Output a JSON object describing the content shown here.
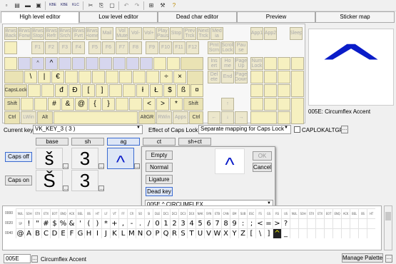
{
  "toolbar": {
    "icons": [
      "new-icon",
      "open-icon",
      "save-icon",
      "copy-icon",
      "keyboard-kbe-icon",
      "keyboard-kbe2-icon",
      "keyboard-klc-icon",
      "cut-icon",
      "copy2-icon",
      "paste-icon",
      "undo-icon",
      "redo-icon",
      "grid-icon",
      "tools-icon",
      "help-icon"
    ],
    "labels": [
      "▫",
      "▤",
      "▬",
      "▣",
      "KBE",
      "KBE",
      "KLC",
      "✂",
      "⎘",
      "▢",
      "↶",
      "↷",
      "⊞",
      "⚒",
      "?"
    ]
  },
  "tabs": [
    {
      "label": "High level editor"
    },
    {
      "label": "Low level editor"
    },
    {
      "label": "Dead char editor"
    },
    {
      "label": "Preview"
    },
    {
      "label": "Sticker map"
    }
  ],
  "keyboard": {
    "row_media": [
      "Brws Back",
      "Brws Forw",
      "Brws Stop",
      "Brws Refr",
      "Brws Srch",
      "Brws Fvrt",
      "Brws Home",
      "Mail",
      "Vol Mute",
      "Vol-",
      "Vol+",
      "Play Paus",
      "Stop",
      "Prev Trck",
      "Next Trck",
      "Med ia",
      "App1",
      "App2",
      "Sleep"
    ],
    "row_fn": [
      "F1",
      "F2",
      "F3",
      "F4",
      "F5",
      "F6",
      "F7",
      "F8",
      "F9",
      "F10",
      "F11",
      "F12",
      "Prnt Scrn",
      "Scroll Lock",
      "Pau se"
    ],
    "row_num": [
      "",
      "",
      "^",
      "",
      "",
      "",
      "",
      "",
      "",
      "",
      "",
      "",
      "",
      ""
    ],
    "nav1": [
      "Ins ert",
      "Ho me",
      "Page Up",
      "Num Lock"
    ],
    "row_q": [
      "",
      "\\",
      "|",
      "€",
      "",
      "",
      "",
      "",
      "",
      "",
      "",
      "÷",
      "×"
    ],
    "nav2": [
      "Del ete",
      "End",
      "Page Down"
    ],
    "caps": "CapsLock",
    "row_a": [
      "",
      "",
      "đ",
      "Đ",
      "[",
      "]",
      "",
      "",
      "ł",
      "Ł",
      "$",
      "ß",
      "¤"
    ],
    "shift_l": "Shift",
    "row_z": [
      "",
      "",
      "#",
      "&",
      "@",
      "{",
      "}",
      "",
      "",
      "<",
      ">",
      "*"
    ],
    "shift_r": "Shift",
    "ctrl_l": "Ctrl",
    "lwin": "LWin",
    "alt": "Alt",
    "altgr": "AltGR",
    "rwin": "RWin",
    "apps": "Apps",
    "ctrl_r": "Ctrl",
    "arrows": [
      "←",
      "↑",
      "↓",
      "→"
    ],
    "preview_glyph": "^",
    "preview_caption": "005E: Circumflex Accent"
  },
  "current_key": {
    "label": "Current key",
    "value": "VK_KEY_3 ( 3 )"
  },
  "caps_effect": {
    "label": "Effect of Caps Lock",
    "value": "Separate mapping for Caps Lock",
    "checkbox_label": "CAPLOKALTGR"
  },
  "columns": [
    "base",
    "sh",
    "ag",
    "ct",
    "sh+ct"
  ],
  "buttons": {
    "caps_off": "Caps off",
    "caps_on": "Caps on",
    "empty": "Empty",
    "normal": "Normal",
    "ligature": "Ligature",
    "dead_key": "Dead key",
    "ok": "OK",
    "cancel": "Cancel",
    "manage_palette": "Manage Palette"
  },
  "cells": {
    "off_base": "š",
    "off_sh": "3",
    "off_ag": "^",
    "on_base": "Š",
    "on_sh": "3"
  },
  "popup": {
    "glyph": "^",
    "dropdown": "005E ^ CIRCUMFLEX"
  },
  "charmap": {
    "rows": [
      {
        "hdr": "0000",
        "cells": [
          "NUL",
          "SOH",
          "STX",
          "ETX",
          "EOT",
          "ENQ",
          "ACK",
          "BEL",
          "BS",
          "HT",
          "LF",
          "VT",
          "FF",
          "CR",
          "SO",
          "SI",
          "DLE",
          "DC1",
          "DC2",
          "DC3",
          "DC4",
          "NAK",
          "SYN",
          "ETB",
          "CAN",
          "EM",
          "SUB",
          "ESC",
          "FS",
          "GS",
          "RS",
          "US",
          "NUL",
          "SOH",
          "STX",
          "ETX",
          "EOT",
          "ENQ",
          "ACK",
          "BEL",
          "BS",
          "HT"
        ]
      },
      {
        "hdr": "0020",
        "cells": [
          "SP",
          "!",
          "\"",
          "#",
          "$",
          "%",
          "&",
          "'",
          "(",
          ")",
          "*",
          "+",
          ",",
          "-",
          ".",
          "/",
          "0",
          "1",
          "2",
          "3",
          "4",
          "5",
          "6",
          "7",
          "8",
          "9",
          ":",
          ";",
          "<",
          "=",
          ">",
          "?",
          "",
          "",
          "",
          "",
          "",
          "",
          "",
          "",
          "",
          ""
        ]
      },
      {
        "hdr": "0040",
        "cells": [
          "@",
          "A",
          "B",
          "C",
          "D",
          "E",
          "F",
          "G",
          "H",
          "I",
          "J",
          "K",
          "L",
          "M",
          "N",
          "O",
          "P",
          "Q",
          "R",
          "S",
          "T",
          "U",
          "V",
          "W",
          "X",
          "Y",
          "Z",
          "[",
          "\\",
          "]",
          "^",
          "_",
          "",
          "",
          "",
          "",
          "",
          "",
          "",
          "",
          "",
          ""
        ]
      }
    ]
  },
  "bottom": {
    "code": "005E",
    "name": "Circumflex Accent"
  }
}
